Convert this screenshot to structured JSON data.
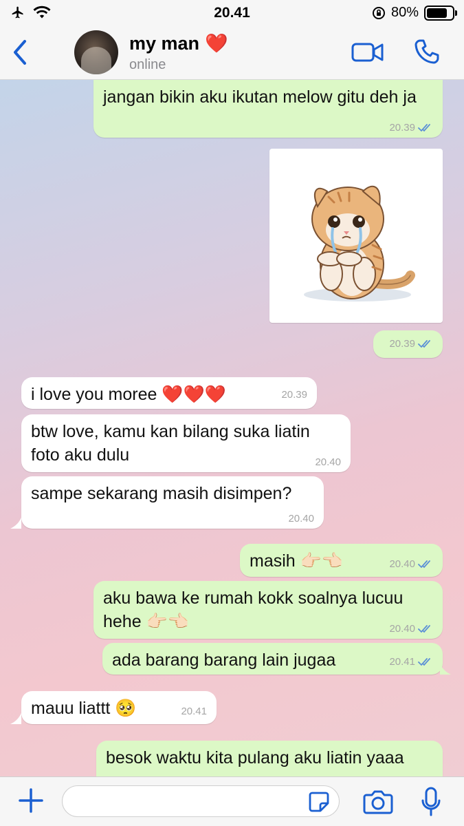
{
  "status_bar": {
    "time": "20.41",
    "battery": "80%",
    "battery_level": 0.8
  },
  "header": {
    "name": "my man",
    "name_emoji": "❤️",
    "status": "online",
    "icons": [
      "back-chevron-icon",
      "video-call-icon",
      "phone-icon"
    ]
  },
  "messages": [
    {
      "dir": "out",
      "text": "jangan bikin aku ikutan melow gitu deh ja",
      "time": "20.39",
      "ticks": "read"
    },
    {
      "dir": "out",
      "type": "image",
      "image": "crying-kitten-sticker",
      "time": "20.39",
      "ticks": "read"
    },
    {
      "dir": "in",
      "text": "i love you moree ❤️❤️❤️",
      "time": "20.39"
    },
    {
      "dir": "in",
      "text": "btw love, kamu kan bilang suka liatin foto aku dulu",
      "time": "20.40"
    },
    {
      "dir": "in",
      "text": "sampe sekarang masih disimpen?",
      "time": "20.40"
    },
    {
      "dir": "out",
      "text": "masih 👉🏻👈🏻",
      "time": "20.40",
      "ticks": "read"
    },
    {
      "dir": "out",
      "text": "aku bawa ke rumah kokk soalnya lucuu hehe 👉🏻👈🏻",
      "time": "20.40",
      "ticks": "read"
    },
    {
      "dir": "out",
      "text": "ada barang barang lain jugaa",
      "time": "20.41",
      "ticks": "read"
    },
    {
      "dir": "in",
      "text": "mauu liattt 🥺",
      "time": "20.41"
    },
    {
      "dir": "out",
      "text": "besok waktu kita pulang aku liatin yaaa",
      "time": "",
      "ticks": ""
    }
  ],
  "input_bar": {
    "placeholder": "",
    "icons": [
      "plus-icon",
      "sticker-icon",
      "camera-icon",
      "microphone-icon"
    ]
  },
  "colors": {
    "accent": "#1a5fd1",
    "outgoing_bubble": "#dcf8c6",
    "incoming_bubble": "#ffffff",
    "read_ticks": "#5b8fd6"
  }
}
